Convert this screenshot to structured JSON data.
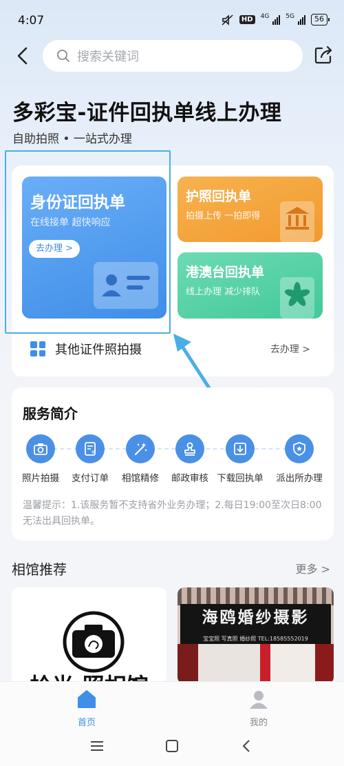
{
  "status_bar": {
    "time": "4:07",
    "network_label": "4G",
    "network_label2": "5G",
    "hd_label": "HD",
    "battery": "56"
  },
  "search": {
    "placeholder": "搜索关键词"
  },
  "header": {
    "title": "多彩宝-证件回执单线上办理",
    "subtitle": "自助拍照 • 一站式办理"
  },
  "services": {
    "id_card": {
      "title": "身份证回执单",
      "subtitle": "在线接单 超快响应",
      "action": "去办理 >"
    },
    "passport": {
      "title": "护照回执单",
      "subtitle": "拍摄上传 一拍即得"
    },
    "hk_macau_tw": {
      "title": "港澳台回执单",
      "subtitle": "线上办理 减少排队"
    },
    "other": {
      "label": "其他证件照拍摄",
      "action": "去办理 >"
    }
  },
  "intro": {
    "title": "服务简介",
    "steps": [
      {
        "label": "照片拍摄",
        "icon": "camera-icon"
      },
      {
        "label": "支付订单",
        "icon": "receipt-icon"
      },
      {
        "label": "相馆精修",
        "icon": "magic-wand-icon"
      },
      {
        "label": "邮政审核",
        "icon": "stamp-icon"
      },
      {
        "label": "下载回执单",
        "icon": "download-icon"
      },
      {
        "label": "派出所办理",
        "icon": "police-badge-icon"
      }
    ],
    "tip": "温馨提示：1.该服务暂不支持省外业务办理；2.每日19:00至次日8:00无法出具回执单。"
  },
  "studios": {
    "title": "相馆推荐",
    "more": "更多 >",
    "items": [
      {
        "name": "拾光·照相馆"
      },
      {
        "sign": "海鸥婚纱摄影",
        "sign_small": "宝宝照    写真照    婚纱照          TEL:18585552019"
      }
    ]
  },
  "bottom_nav": {
    "home": "首页",
    "mine": "我的"
  },
  "colors": {
    "primary": "#3f8ee8",
    "orange": "#f29a2e",
    "green": "#43c89a",
    "highlight": "#4aaee6"
  }
}
